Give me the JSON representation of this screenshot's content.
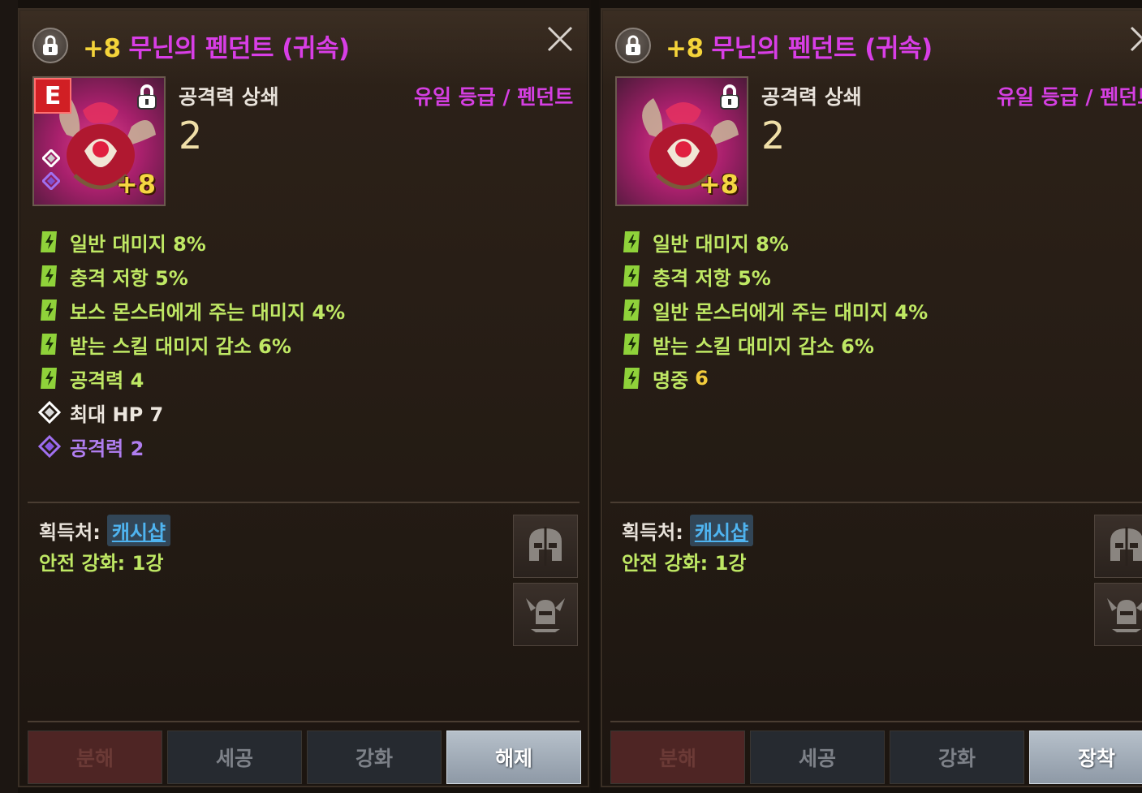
{
  "left_panel": {
    "title_plus": "+8",
    "title_name": "무닌의 펜던트 (귀속)",
    "tier_letter": "E",
    "enhance_label": "+8",
    "stat_label": "공격력 상쇄",
    "stat_value": "2",
    "grade": "유일 등급 / 펜던트",
    "options": [
      {
        "icon": "green-rune-icon",
        "text": "일반 대미지 8%"
      },
      {
        "icon": "green-rune-icon",
        "text": "충격 저항 5%"
      },
      {
        "icon": "green-rune-icon",
        "text": "보스 몬스터에게 주는 대미지 4%"
      },
      {
        "icon": "green-rune-icon",
        "text": "받는 스킬 대미지 감소 6%"
      },
      {
        "icon": "green-rune-icon",
        "text": "공격력 4"
      },
      {
        "icon": "white-diamond-icon",
        "text": "최대 HP 7"
      },
      {
        "icon": "purple-diamond-icon",
        "text": "공격력 2"
      }
    ],
    "source_label": "획득처:",
    "source_link": "캐시샵",
    "safe_enhance": "안전 강화: 1강",
    "buttons": [
      "분해",
      "세공",
      "강화",
      "해제"
    ]
  },
  "right_panel": {
    "title_plus": "+8",
    "title_name": "무닌의 펜던트 (귀속)",
    "enhance_label": "+8",
    "stat_label": "공격력 상쇄",
    "stat_value": "2",
    "grade": "유일 등급 / 펜던트",
    "options": [
      {
        "icon": "green-rune-icon",
        "text": "일반 대미지 8%"
      },
      {
        "icon": "green-rune-icon",
        "text": "충격 저항 5%"
      },
      {
        "icon": "green-rune-icon",
        "text": "일반 몬스터에게 주는 대미지 4%"
      },
      {
        "icon": "green-rune-icon",
        "text": "받는 스킬 대미지 감소 6%"
      },
      {
        "icon": "green-rune-icon",
        "text": "명중",
        "value": "6"
      }
    ],
    "source_label": "획득처:",
    "source_link": "캐시샵",
    "safe_enhance": "안전 강화: 1강",
    "buttons": [
      "분해",
      "세공",
      "강화",
      "장착"
    ]
  },
  "colors": {
    "title_plus": "#f4d43a",
    "title_name": "#d83ee6",
    "grade": "#d53fe2",
    "option_green": "#bfe864",
    "option_purple": "#b07ef0",
    "link": "#4fb4f0"
  }
}
